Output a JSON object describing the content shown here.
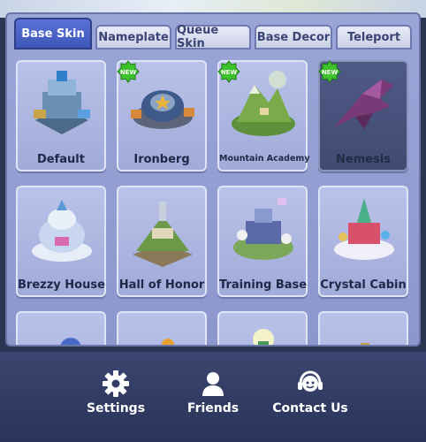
{
  "tabs": [
    {
      "label": "Base Skin",
      "active": true
    },
    {
      "label": "Nameplate",
      "active": false
    },
    {
      "label": "Queue Skin",
      "active": false
    },
    {
      "label": "Base Decor",
      "active": false
    },
    {
      "label": "Teleport",
      "active": false
    }
  ],
  "cards": [
    {
      "label": "Default",
      "new": false,
      "icon": "fortress-icon"
    },
    {
      "label": "Ironberg",
      "new": true,
      "icon": "ironberg-icon"
    },
    {
      "label": "Mountain Academy",
      "new": true,
      "icon": "mountain-icon"
    },
    {
      "label": "Nemesis",
      "new": true,
      "icon": "spaceship-icon"
    },
    {
      "label": "Brezzy House",
      "new": false,
      "icon": "snow-house-icon"
    },
    {
      "label": "Hall of Honor",
      "new": false,
      "icon": "hill-hall-icon"
    },
    {
      "label": "Training Base",
      "new": false,
      "icon": "training-base-icon"
    },
    {
      "label": "Crystal Cabin",
      "new": false,
      "icon": "crystal-cabin-icon"
    }
  ],
  "new_badge_text": "NEW",
  "bottom_buttons": [
    {
      "label": "Settings",
      "icon": "gear-icon"
    },
    {
      "label": "Friends",
      "icon": "person-icon"
    },
    {
      "label": "Contact Us",
      "icon": "headset-icon"
    }
  ],
  "colors": {
    "active_tab": "#4a62c8",
    "panel": "#95a1d3",
    "new_badge": "#3cc22a",
    "bottom_bar": "#2f3961"
  }
}
